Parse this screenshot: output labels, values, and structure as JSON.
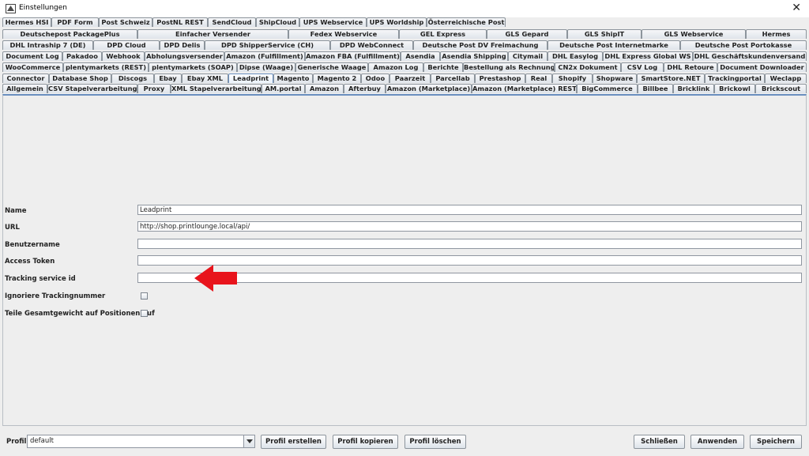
{
  "window": {
    "title": "Einstellungen",
    "close_glyph": "✕"
  },
  "tabs": {
    "rows": [
      [
        "Hermes HSI",
        "PDF Form",
        "Post Schweiz",
        "PostNL REST",
        "SendCloud",
        "ShipCloud",
        "UPS Webservice",
        "UPS Worldship",
        "Österreichische Post"
      ],
      [
        "Deutschepost PackagePlus",
        "Einfacher Versender",
        "Fedex Webservice",
        "GEL Express",
        "GLS Gepard",
        "GLS ShipIT",
        "GLS Webservice",
        "Hermes"
      ],
      [
        "DHL Intraship 7 (DE)",
        "DPD Cloud",
        "DPD Delis",
        "DPD ShipperService (CH)",
        "DPD WebConnect",
        "Deutsche Post DV Freimachung",
        "Deutsche Post Internetmarke",
        "Deutsche Post Portokasse"
      ],
      [
        "Document Log",
        "Pakadoo",
        "Webhook",
        "Abholungsversender",
        "Amazon (Fulfillment)",
        "Amazon FBA (Fulfillment)",
        "Asendia",
        "Asendia Shipping",
        "Citymail",
        "DHL Easylog",
        "DHL Express Global WS",
        "DHL Geschäftskundenversand"
      ],
      [
        "WooCommerce",
        "plentymarkets (REST)",
        "plentymarkets (SOAP)",
        "Dipse (Waage)",
        "Generische Waage",
        "Amazon Log",
        "Berichte",
        "Bestellung als Rechnung",
        "CN2x Dokument",
        "CSV Log",
        "DHL Retoure",
        "Document Downloader"
      ],
      [
        "Connector",
        "Database Shop",
        "Discogs",
        "Ebay",
        "Ebay XML",
        "Leadprint",
        "Magento",
        "Magento 2",
        "Odoo",
        "Paarzeit",
        "Parcellab",
        "Prestashop",
        "Real",
        "Shopify",
        "Shopware",
        "SmartStore.NET",
        "Trackingportal",
        "Weclapp"
      ],
      [
        "Allgemein",
        "CSV Stapelverarbeitung",
        "Proxy",
        "XML Stapelverarbeitung",
        "AM.portal",
        "Amazon",
        "Afterbuy",
        "Amazon (Marketplace)",
        "Amazon (Marketplace) REST",
        "BigCommerce",
        "Billbee",
        "Bricklink",
        "Brickowl",
        "Brickscout"
      ]
    ],
    "selected": "Leadprint"
  },
  "form": {
    "fields": [
      {
        "label": "Name",
        "value": "Leadprint"
      },
      {
        "label": "URL",
        "value": "http://shop.printlounge.local/api/"
      },
      {
        "label": "Benutzername",
        "value": ""
      },
      {
        "label": "Access Token",
        "value": ""
      },
      {
        "label": "Tracking service id",
        "value": ""
      }
    ],
    "checkboxes": [
      {
        "label": "Ignoriere Trackingnummer",
        "checked": false
      },
      {
        "label": "Teile Gesamtgewicht auf Positionen auf",
        "checked": false
      }
    ]
  },
  "annotation": {
    "arrow_color": "#e8141c",
    "points_to": "Tracking service id"
  },
  "bottom": {
    "profil_label": "Profil",
    "profil_value": "default",
    "buttons": {
      "create": "Profil erstellen",
      "copy": "Profil kopieren",
      "delete": "Profil löschen",
      "close": "Schließen",
      "apply": "Anwenden",
      "save": "Speichern"
    }
  }
}
